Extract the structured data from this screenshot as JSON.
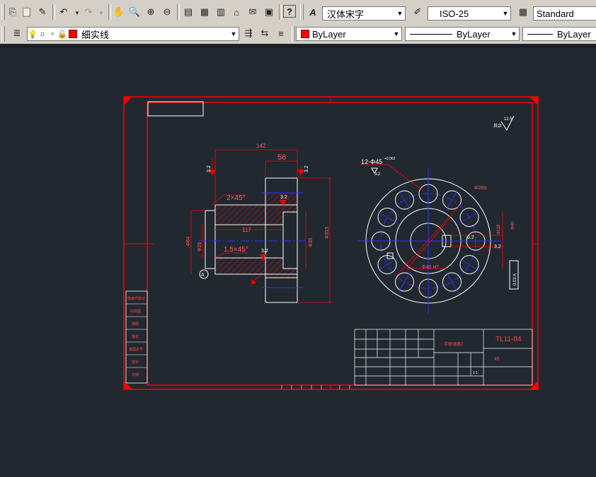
{
  "toolbar1": {
    "text_style": "汉体宋字",
    "dim_style": "ISO-25",
    "table_style": "Standard",
    "icons": [
      "copy-icon",
      "paste-icon",
      "match-properties-icon",
      "undo-icon",
      "redo-icon",
      "pan-icon",
      "zoom-realtime-icon",
      "zoom-window-icon",
      "zoom-previous-icon",
      "properties-icon",
      "design-center-icon",
      "tool-palettes-icon",
      "sheet-set-icon",
      "markup-icon",
      "calculator-icon",
      "help-icon",
      "text-style-icon",
      "dim-style-icon",
      "table-style-icon"
    ]
  },
  "toolbar2": {
    "layer_name": "细实线",
    "color": "ByLayer",
    "linetype": "ByLayer",
    "lineweight": "ByLayer",
    "icons": [
      "layer-manager-icon",
      "lightbulb-icon",
      "sun-icon",
      "lock-icon",
      "make-current-icon",
      "layer-previous-icon",
      "layer-states-icon"
    ]
  },
  "colors": {
    "red": "#ff0000",
    "white": "#ffffff",
    "blue": "#0000ff",
    "background": "#212830"
  },
  "drawing": {
    "dims": {
      "top_width": "142",
      "hub_width": "56",
      "bore_length": "117",
      "chamfer_1": "2×45°",
      "chamfer_2": "1.5×45°",
      "diam_left1": "Φ64",
      "diam_left2": "Φ28",
      "diam_right1": "Φ35",
      "diam_right2": "Φ315",
      "roughness_1": "3.2",
      "roughness_2": "3.2",
      "roughness_3": "3.2",
      "roughness_4": "3.2",
      "roughness_5": "3.2",
      "holes_callout": "12-Φ45",
      "holes_tol": "+0.062",
      "holes_rough": "3.2",
      "pitch_circle": "Φ260",
      "keyway": "3.2",
      "datum": "A",
      "other_rough": "12.5",
      "other_label": "其余",
      "rotated_dim_1": "Φ118",
      "rotated_dim_2": "Φ40",
      "tol_box": "0.03 A",
      "bore_dim": "Φ40 H7"
    },
    "title_block": {
      "drawing_no": "TL11-04",
      "material": "45",
      "part_name": "半联轴器2",
      "scale_ratio": "1:1"
    },
    "side_labels": [
      "借用件登记",
      "旧底图",
      "描图",
      "描校",
      "底图总号",
      "签字",
      "日期"
    ]
  }
}
